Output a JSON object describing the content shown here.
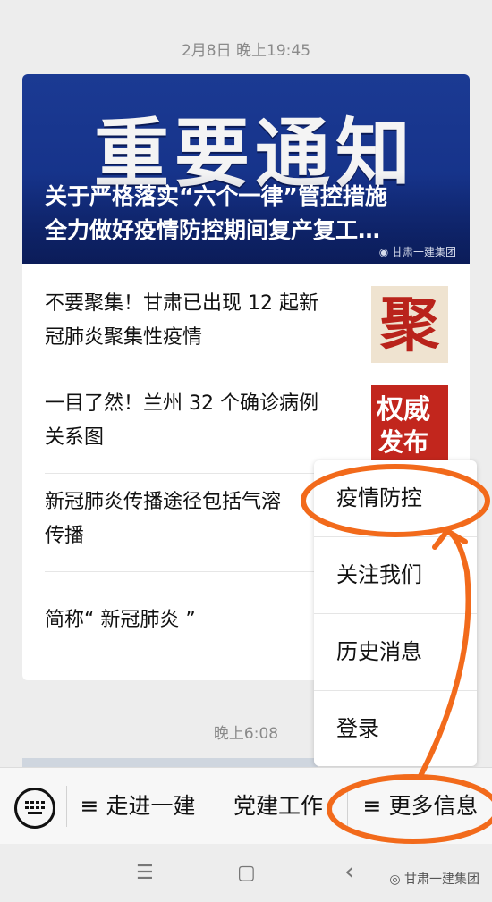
{
  "chat": {
    "timestamp_1": "2月8日 晚上19:45",
    "timestamp_2": "晚上6:08"
  },
  "article_card": {
    "banner_big_text": "重要通知",
    "banner_title": "关于严格落实“六个一律”管控措施\n全力做好疫情防控期间复产复工…",
    "banner_source": "甘肃一建集团",
    "items": [
      {
        "title": "不要聚集！甘肃已出现 12 起新\n冠肺炎聚集性疫情",
        "thumb_text": "聚"
      },
      {
        "title": "一目了然！兰州 32 个确诊病例\n关系图",
        "thumb_text_1": "权威",
        "thumb_text_2": "发布"
      },
      {
        "title": "新冠肺炎传播途径包括气溶\n传播"
      },
      {
        "title": "简称“ 新冠肺炎 ”"
      }
    ]
  },
  "popup_menu": {
    "items": [
      "疫情防控",
      "关注我们",
      "历史消息",
      "登录"
    ]
  },
  "bottom_bar": {
    "tab_1": "≡ 走进一建",
    "tab_2": "党建工作",
    "tab_3": "≡ 更多信息",
    "keyboard_icon": "keyboard-icon"
  },
  "system_nav": {
    "menu_icon": "☰",
    "home_icon": "▢",
    "back_icon": "‹",
    "watermark": "甘肃一建集团"
  },
  "colors": {
    "banner_blue": "#1b3a93",
    "annotation_orange": "#f26a1b",
    "thumb_red": "#c2261d"
  }
}
